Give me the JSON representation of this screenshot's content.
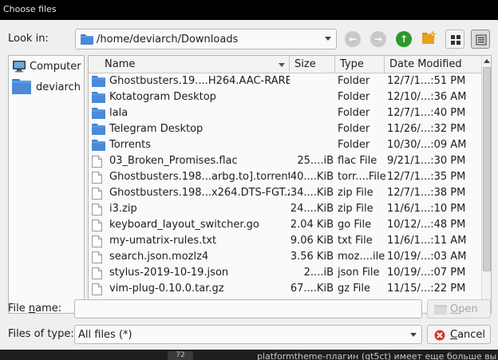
{
  "window": {
    "title": "Choose files"
  },
  "toolbar": {
    "look_in_label": "Look in:",
    "path": "/home/deviarch/Downloads"
  },
  "sidebar": {
    "items": [
      {
        "label": "Computer",
        "icon": "computer-icon"
      },
      {
        "label": "deviarch",
        "icon": "folder-icon"
      }
    ]
  },
  "columns": {
    "name": "Name",
    "size": "Size",
    "type": "Type",
    "date": "Date Modified"
  },
  "files": [
    {
      "name": "Ghostbusters.19....H264.AAC-RARBG",
      "size": "",
      "type": "Folder",
      "date": "12/7/1...:51 PM",
      "kind": "folder"
    },
    {
      "name": "Kotatogram Desktop",
      "size": "",
      "type": "Folder",
      "date": "12/10/...:36 AM",
      "kind": "folder"
    },
    {
      "name": "lala",
      "size": "",
      "type": "Folder",
      "date": "12/7/1...:40 PM",
      "kind": "folder"
    },
    {
      "name": "Telegram Desktop",
      "size": "",
      "type": "Folder",
      "date": "11/26/...:32 PM",
      "kind": "folder"
    },
    {
      "name": "Torrents",
      "size": "",
      "type": "Folder",
      "date": "10/30/...:09 AM",
      "kind": "folder"
    },
    {
      "name": "03_Broken_Promises.flac",
      "size": "25....iB",
      "type": "flac File",
      "date": "9/21/1...:30 PM",
      "kind": "file"
    },
    {
      "name": "Ghostbusters.198...arbg.to].torrent",
      "size": "40....KiB",
      "type": "torr....File",
      "date": "12/7/1...:35 PM",
      "kind": "file"
    },
    {
      "name": "Ghostbusters.198...x264.DTS-FGT.zip",
      "size": "34....KiB",
      "type": "zip File",
      "date": "12/7/1...:38 PM",
      "kind": "file"
    },
    {
      "name": "i3.zip",
      "size": "24....KiB",
      "type": "zip File",
      "date": "11/6/1...:10 PM",
      "kind": "file"
    },
    {
      "name": "keyboard_layout_switcher.go",
      "size": "2.04 KiB",
      "type": "go File",
      "date": "10/12/...:48 PM",
      "kind": "file"
    },
    {
      "name": "my-umatrix-rules.txt",
      "size": "9.06 KiB",
      "type": "txt File",
      "date": "11/6/1...:11 AM",
      "kind": "file"
    },
    {
      "name": "search.json.mozlz4",
      "size": "3.56 KiB",
      "type": "moz....ile",
      "date": "10/19/...:03 AM",
      "kind": "file"
    },
    {
      "name": "stylus-2019-10-19.json",
      "size": "2....iB",
      "type": "json File",
      "date": "10/19/...:07 PM",
      "kind": "file"
    },
    {
      "name": "vim-plug-0.10.0.tar.gz",
      "size": "67....KiB",
      "type": "gz File",
      "date": "11/15/...:22 PM",
      "kind": "file"
    }
  ],
  "form": {
    "file_name_label_pre": "File ",
    "file_name_label_ul": "n",
    "file_name_label_post": "ame:",
    "file_name_value": "",
    "files_of_type_label": "Files of type:",
    "files_of_type_value": "All files (*)"
  },
  "buttons": {
    "open_ul": "O",
    "open_rest": "pen",
    "cancel_ul": "C",
    "cancel_rest": "ancel"
  },
  "background_peek": {
    "text": "platformtheme-плагин (qt5ct) имеет еще больше вы",
    "tab": "72"
  }
}
